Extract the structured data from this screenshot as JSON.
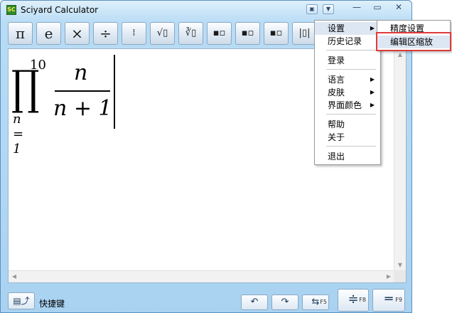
{
  "window": {
    "title": "Sciyard Calculator",
    "icon_text": "SC",
    "controls": [
      "save-icon",
      "dropdown-icon",
      "minimize-icon",
      "maximize-icon",
      "close-icon"
    ]
  },
  "toolbar": {
    "buttons": [
      {
        "label": "π",
        "icon": "pi"
      },
      {
        "label": "e",
        "icon": "e-constant"
      },
      {
        "label": "×",
        "icon": "multiply"
      },
      {
        "label": "÷",
        "icon": "divide"
      },
      {
        "label": "⁞",
        "icon": "fraction"
      },
      {
        "label": "√▯",
        "icon": "square-root"
      },
      {
        "label": "∛▯",
        "icon": "nth-root"
      },
      {
        "label": "▪▫",
        "icon": "superscript"
      },
      {
        "label": "▪▫",
        "icon": "subscript"
      },
      {
        "label": "▪▫",
        "icon": "sub-superscript"
      },
      {
        "label": "|▯|",
        "icon": "absolute-value"
      }
    ]
  },
  "editor": {
    "expression": {
      "upper_limit": "10",
      "operator": "∏",
      "lower_limit": "n = 1",
      "numerator": "n",
      "denominator": "n + 1"
    }
  },
  "bottombar": {
    "shortcut_label": "快捷键",
    "f5": "F5",
    "f8": "F8",
    "f9": "F9"
  },
  "main_menu": {
    "items": [
      {
        "label": "设置",
        "has_submenu": true,
        "active": true
      },
      {
        "label": "历史记录"
      },
      {
        "label": "登录"
      },
      {
        "label": "语言",
        "has_submenu": true
      },
      {
        "label": "皮肤",
        "has_submenu": true
      },
      {
        "label": "界面颜色",
        "has_submenu": true
      },
      {
        "label": "帮助"
      },
      {
        "label": "关于"
      },
      {
        "label": "退出"
      }
    ]
  },
  "sub_menu": {
    "items": [
      {
        "label": "精度设置"
      },
      {
        "label": "编辑区缩放",
        "highlighted": true
      }
    ]
  },
  "colors": {
    "window_frame": "#a9d2f1",
    "highlight_border": "#e03a3a",
    "menu_active": "#dde7f3"
  }
}
